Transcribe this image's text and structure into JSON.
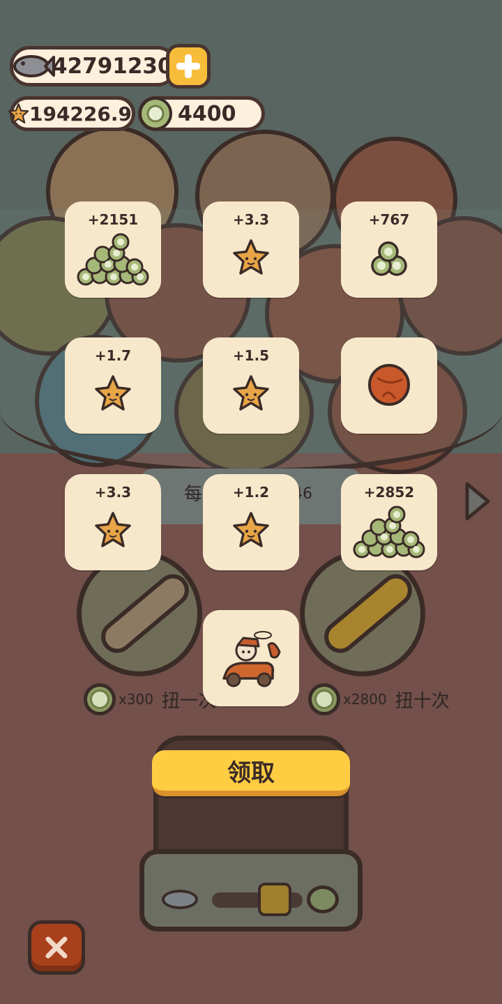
{
  "currency": {
    "fish_amount": "42791230",
    "star_amount": "194226.9",
    "coin_amount": "4400"
  },
  "machine": {
    "sign_text": "每",
    "sign_number": "46",
    "spin_once": {
      "cost": "x300",
      "label": "扭一次"
    },
    "spin_ten": {
      "cost": "x2800",
      "label": "扭十次"
    }
  },
  "rewards": [
    {
      "value": "+2151",
      "icon": "coin-pile-large-icon"
    },
    {
      "value": "+3.3",
      "icon": "star-icon"
    },
    {
      "value": "+767",
      "icon": "coin-stack-icon"
    },
    {
      "value": "+1.7",
      "icon": "star-icon"
    },
    {
      "value": "+1.5",
      "icon": "star-icon"
    },
    {
      "value": "",
      "icon": "brown-capsule-ball-icon"
    },
    {
      "value": "+3.3",
      "icon": "star-icon"
    },
    {
      "value": "+1.2",
      "icon": "star-icon"
    },
    {
      "value": "+2852",
      "icon": "coin-pile-large-icon"
    },
    {
      "value": "",
      "icon": "cat-racing-car-icon"
    }
  ],
  "claim_button": {
    "label": "领取"
  },
  "colors": {
    "card_bg": "#f7e8cb",
    "claim_yellow": "#ffcd42",
    "close_red": "#a9401c",
    "background_brown": "#735049"
  }
}
